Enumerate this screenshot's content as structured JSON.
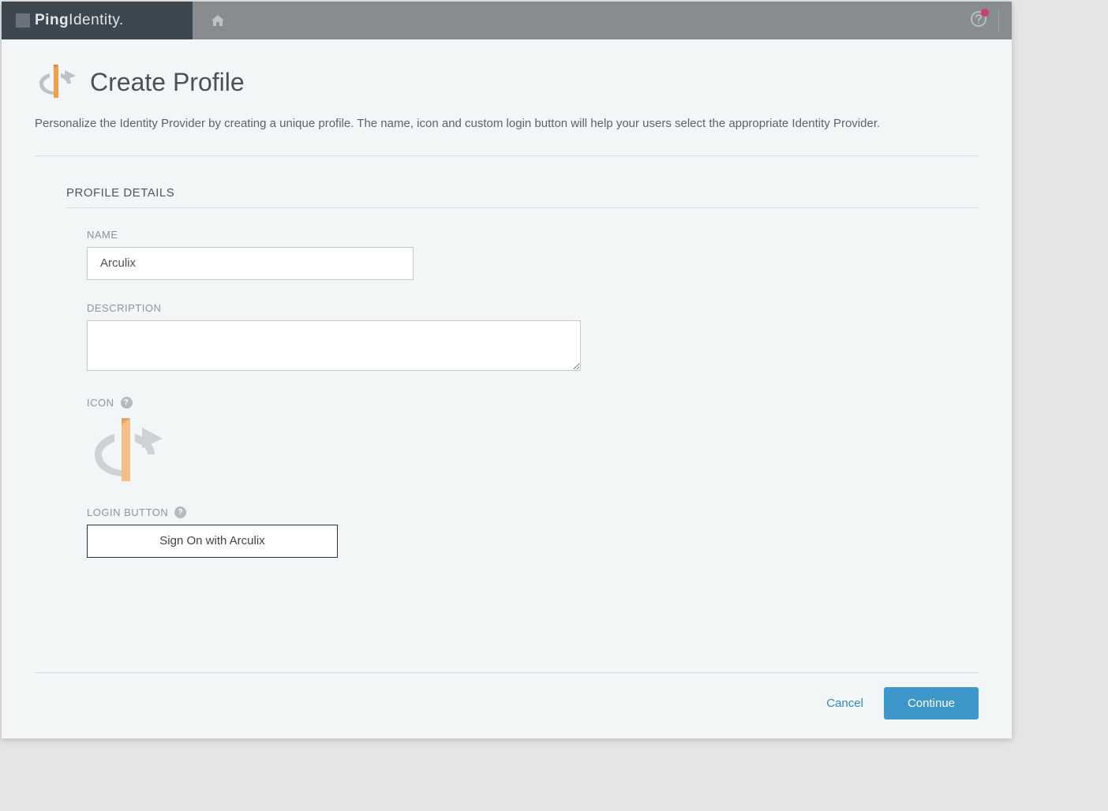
{
  "header": {
    "logo_text_bold": "Ping",
    "logo_text_light": "Identity."
  },
  "page": {
    "title": "Create Profile",
    "description": "Personalize the Identity Provider by creating a unique profile. The name, icon and custom login button will help your users select the appropriate Identity Provider."
  },
  "form": {
    "section_title": "PROFILE DETAILS",
    "name_label": "NAME",
    "name_value": "Arculix",
    "description_label": "DESCRIPTION",
    "description_value": "",
    "icon_label": "ICON",
    "login_button_label": "LOGIN BUTTON",
    "login_button_text": "Sign On with Arculix"
  },
  "footer": {
    "cancel_label": "Cancel",
    "continue_label": "Continue"
  },
  "colors": {
    "accent_orange": "#f0a04c",
    "accent_blue": "#3e97cb",
    "accent_pink": "#c5446e"
  }
}
